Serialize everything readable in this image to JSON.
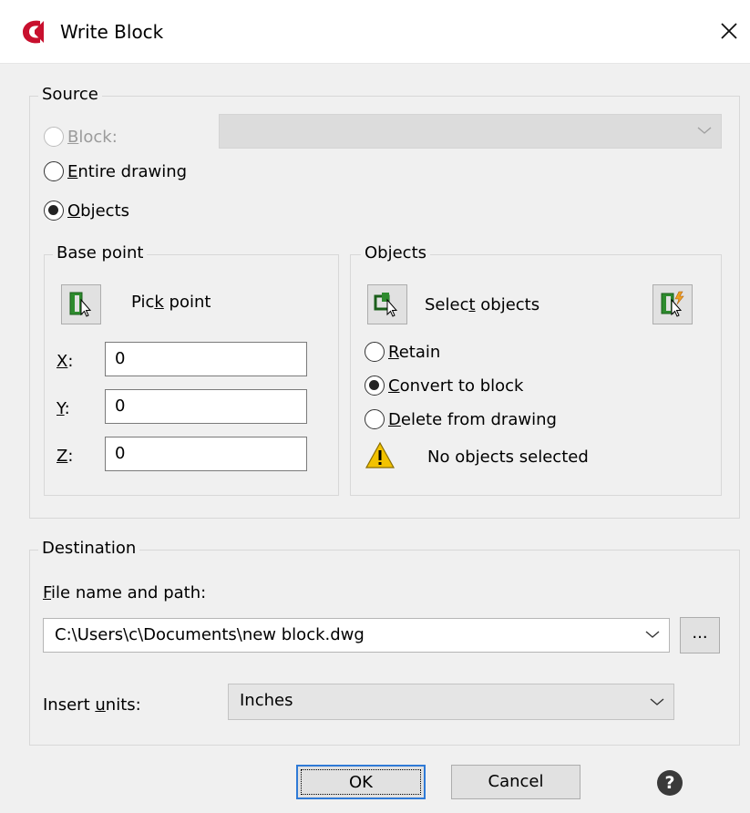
{
  "window": {
    "title": "Write Block"
  },
  "source": {
    "legend": "Source",
    "block_label_mn": "B",
    "block_label_rest": "lock:",
    "entire_mn": "E",
    "entire_rest": "ntire drawing",
    "objects_mn": "O",
    "objects_rest": "bjects",
    "selected": "Objects"
  },
  "base_point": {
    "legend": "Base point",
    "pick_pre": "Pic",
    "pick_mn": "k",
    "pick_post": " point",
    "x_label": "X",
    "y_label": "Y",
    "z_label": "Z",
    "colon": ":",
    "x": "0",
    "y": "0",
    "z": "0"
  },
  "objects": {
    "legend": "Objects",
    "select_pre": "Selec",
    "select_mn": "t",
    "select_post": " objects",
    "retain_mn": "R",
    "retain_rest": "etain",
    "convert_mn": "C",
    "convert_rest": "onvert to block",
    "delete_mn": "D",
    "delete_rest": "elete from drawing",
    "selected_option": "Convert to block",
    "status": "No objects selected"
  },
  "destination": {
    "legend": "Destination",
    "file_label_mn": "F",
    "file_label_rest": "ile name and path:",
    "file_path": "C:\\Users\\c\\Documents\\new block.dwg",
    "browse_label": "...",
    "units_pre": "Insert ",
    "units_mn": "u",
    "units_post": "nits:",
    "units_value": "Inches"
  },
  "buttons": {
    "ok": "OK",
    "cancel": "Cancel",
    "help": "?"
  },
  "colors": {
    "accent": "#2f7ad6",
    "app_icon": "#c8102e",
    "icon_green": "#2e8b2e"
  }
}
